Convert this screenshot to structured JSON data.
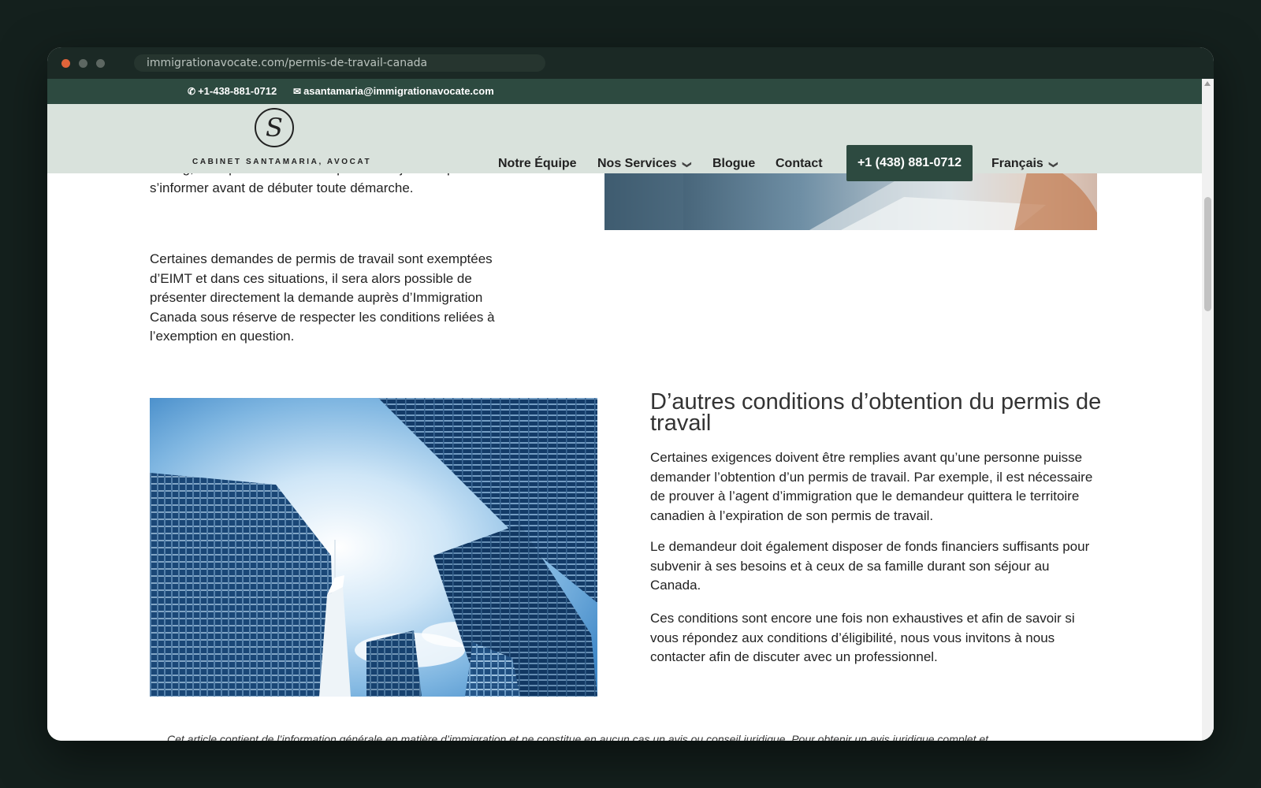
{
  "browser": {
    "url": "immigrationavocate.com/permis-de-travail-canada"
  },
  "topbar": {
    "phone": "+1-438-881-0712",
    "email": "asantamaria@immigrationavocate.com"
  },
  "logo": {
    "text": "CABINET SANTAMARIA, AVOCAT",
    "monogram": "S"
  },
  "nav": {
    "items": [
      {
        "label": "Notre Équipe"
      },
      {
        "label": "Nos Services"
      },
      {
        "label": "Blogue"
      },
      {
        "label": "Contact"
      }
    ],
    "cta": "+1 (438) 881-0712",
    "language": "Français"
  },
  "content": {
    "para_top": "et long, c’est pour cette raison qu’il est toujours important de s’informer avant de débuter toute démarche.",
    "para_exempt": "Certaines demandes de permis de travail sont exemptées d’EIMT et dans ces situations, il sera alors possible de présenter directement la demande auprès d’Immigration Canada sous réserve de respecter les conditions reliées à l’exemption en question.",
    "section_title": "D’autres conditions d’obtention du permis de travail",
    "p1": "Certaines exigences doivent être remplies avant qu’une personne puisse demander l’obtention d’un permis de travail. Par exemple, il est nécessaire de prouver à l’agent d’immigration que le demandeur quittera le territoire canadien à l’expiration de son permis de travail.",
    "p2": "Le demandeur doit également disposer de fonds financiers suffisants pour subvenir à ses besoins et à ceux de sa famille durant son séjour au Canada.",
    "p3": "Ces conditions sont encore une fois non exhaustives et afin de savoir si vous répondez aux conditions d’éligibilité, nous vous invitons à nous contacter afin de discuter avec un professionnel.",
    "disclaimer": "Cet article contient de l’information générale en matière d’immigration et ne constitue en aucun cas un avis ou conseil juridique. Pour obtenir un avis juridique complet et"
  },
  "colors": {
    "brand": "#2d4a40",
    "nav_bg": "#d9e2dc",
    "page_bg": "#14201d"
  },
  "icons": {
    "phone": "phone-icon",
    "mail": "mail-icon",
    "chevron": "chevron-down-icon"
  }
}
